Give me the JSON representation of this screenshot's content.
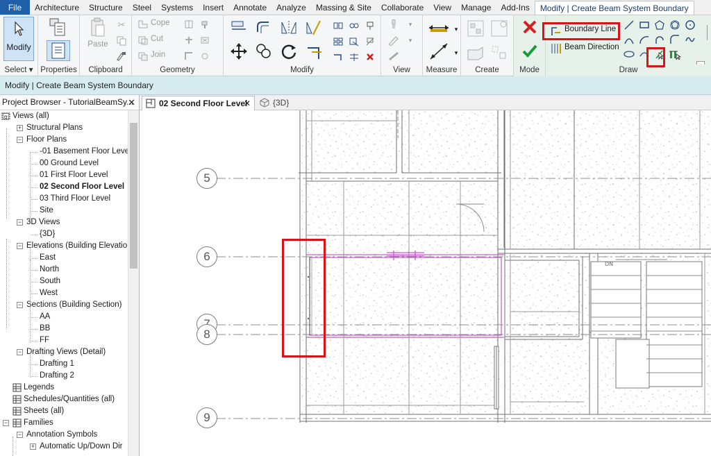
{
  "tabs": {
    "file": "File",
    "items": [
      "Architecture",
      "Structure",
      "Steel",
      "Systems",
      "Insert",
      "Annotate",
      "Analyze",
      "Massing & Site",
      "Collaborate",
      "View",
      "Manage",
      "Add-Ins"
    ],
    "active": "Modify | Create Beam System Boundary"
  },
  "ribbon": {
    "select": {
      "modify_label": "Modify",
      "panel": "Select ▾"
    },
    "properties": {
      "panel": "Properties"
    },
    "clipboard": {
      "paste": "Paste",
      "panel": "Clipboard"
    },
    "geometry": {
      "cope": "Cope",
      "cut": "Cut",
      "join": "Join",
      "panel": "Geometry"
    },
    "modify": {
      "panel": "Modify"
    },
    "view": {
      "panel": "View"
    },
    "measure": {
      "panel": "Measure"
    },
    "create": {
      "panel": "Create"
    },
    "mode": {
      "panel": "Mode"
    },
    "draw": {
      "boundary_line": "Boundary Line",
      "beam_direction": "Beam Direction",
      "panel": "Draw"
    }
  },
  "status": {
    "text": "Modify | Create Beam System Boundary"
  },
  "browser": {
    "title": "Project Browser - TutorialBeamSy...",
    "close": "✕",
    "nodes": [
      "Views (all)",
      "Structural Plans",
      "Floor Plans",
      "-01 Basement Floor Leve",
      "00 Ground Level",
      "01 First Floor Level",
      "02 Second Floor Level",
      "03 Third Floor Level",
      "Site",
      "3D Views",
      "{3D}",
      "Elevations (Building Elevatio",
      "East",
      "North",
      "South",
      "West",
      "Sections (Building Section)",
      "AA",
      "BB",
      "FF",
      "Drafting Views (Detail)",
      "Drafting 1",
      "Drafting 2",
      "Legends",
      "Schedules/Quantities (all)",
      "Sheets (all)",
      "Families",
      "Annotation Symbols",
      "Automatic Up/Down Dir"
    ]
  },
  "view_tabs": [
    {
      "label": "02 Second Floor Level",
      "close": "✕"
    },
    {
      "label": "{3D}"
    }
  ],
  "canvas": {
    "grid_labels": [
      "5",
      "6",
      "7",
      "8",
      "9"
    ],
    "stair_label": "DN"
  },
  "colors": {
    "accent_file": "#1e5fa8",
    "highlight": "#d6141c",
    "sketch": "#c659c9",
    "status_bar": "#d6ecf1"
  }
}
